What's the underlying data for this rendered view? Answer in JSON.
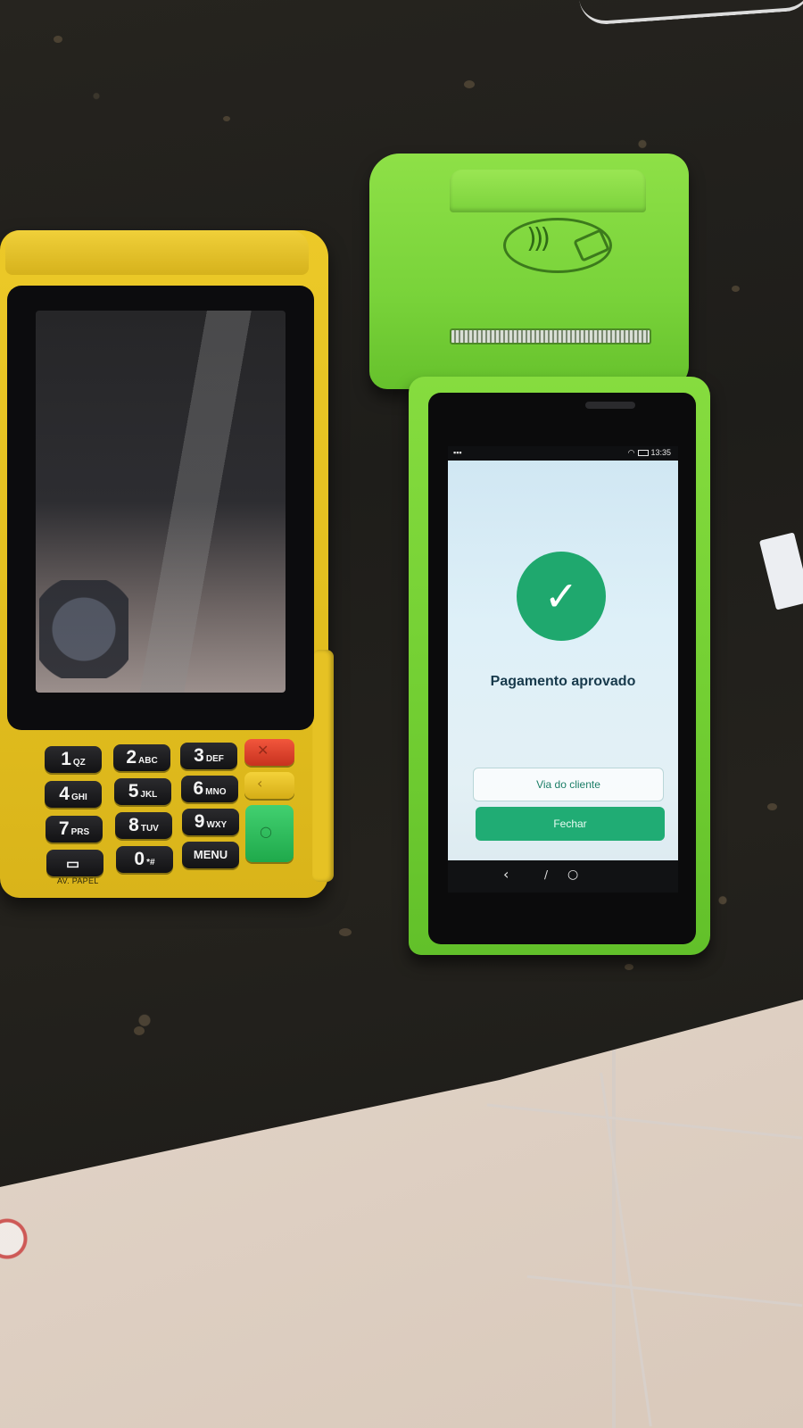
{
  "scene": "two-payment-terminals-on-counter",
  "colors": {
    "yellow_terminal": "#e3bf1f",
    "green_terminal": "#79d33a",
    "success_green": "#1fa86e",
    "button_green": "#20ac74",
    "title_text": "#183a4c"
  },
  "yellow_terminal": {
    "keys": [
      {
        "digit": "1",
        "letters": "QZ"
      },
      {
        "digit": "2",
        "letters": "ABC"
      },
      {
        "digit": "3",
        "letters": "DEF"
      },
      {
        "digit": "4",
        "letters": "GHI"
      },
      {
        "digit": "5",
        "letters": "JKL"
      },
      {
        "digit": "6",
        "letters": "MNO"
      },
      {
        "digit": "7",
        "letters": "PRS"
      },
      {
        "digit": "8",
        "letters": "TUV"
      },
      {
        "digit": "9",
        "letters": "WXY"
      },
      {
        "digit": "0",
        "letters": "*#"
      }
    ],
    "menu_key": "MENU",
    "paper_key_label": "AV. PAPEL",
    "icons": {
      "cancel": "x-icon",
      "correct": "back-arrow-icon",
      "confirm": "circle-icon",
      "paper": "printer-icon"
    }
  },
  "green_terminal": {
    "status_bar": {
      "time": "13:35",
      "icons": [
        "signal-icon",
        "wifi-icon",
        "battery-icon"
      ]
    },
    "screen": {
      "icon": "check-icon",
      "title": "Pagamento aprovado",
      "secondary_button": "Via do cliente",
      "primary_button": "Fechar"
    },
    "nav_icons": [
      "back-icon",
      "home-icon",
      "recents-icon"
    ],
    "printer_icon": "contactless-payment-icon"
  }
}
